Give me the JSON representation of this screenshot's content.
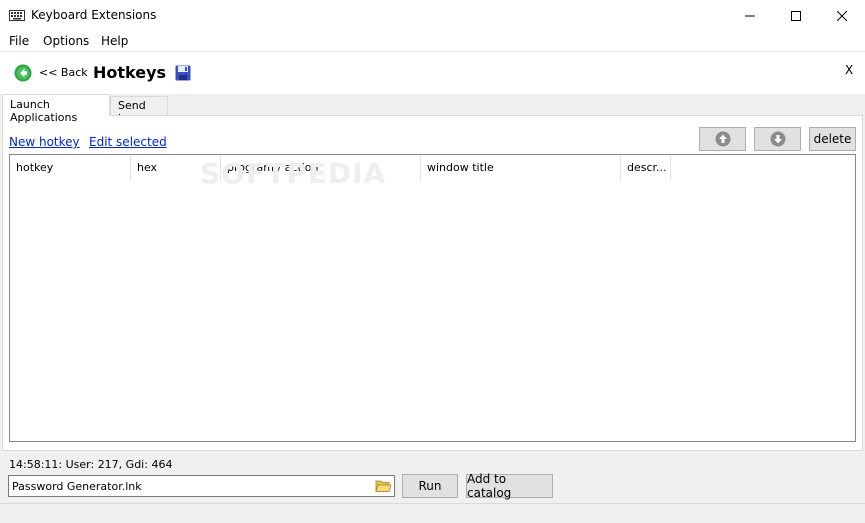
{
  "window": {
    "title": "Keyboard Extensions",
    "minimize_icon": "minimize-icon",
    "maximize_icon": "maximize-icon",
    "close_icon": "close-icon"
  },
  "menu": {
    "items": [
      "File",
      "Options",
      "Help"
    ]
  },
  "header": {
    "back_label": "<< Back",
    "title": "Hotkeys",
    "close_label": "X",
    "back_icon": "back-arrow-icon",
    "save_icon": "floppy-disk-icon"
  },
  "tabs": [
    {
      "label": "Launch Applications",
      "active": true
    },
    {
      "label": "Send keys",
      "active": false
    }
  ],
  "toolbar": {
    "new_hotkey": "New hotkey",
    "edit_selected": "Edit selected",
    "move_up_icon": "arrow-up-icon",
    "move_down_icon": "arrow-down-icon",
    "delete_label": "delete"
  },
  "table": {
    "columns": [
      "hotkey",
      "hex",
      "program / action",
      "window title",
      "descr..."
    ],
    "rows": []
  },
  "watermark": "SOFTPEDIA",
  "status": {
    "text": "14:58:11: User: 217, Gdi: 464"
  },
  "bottom": {
    "path_value": "Password Generator.lnk",
    "browse_icon": "folder-open-icon",
    "run_label": "Run",
    "add_catalog_label": "Add to catalog"
  },
  "colors": {
    "link": "#0026d6",
    "accent_green": "#2ea043",
    "save_blue": "#3a4fc4"
  }
}
